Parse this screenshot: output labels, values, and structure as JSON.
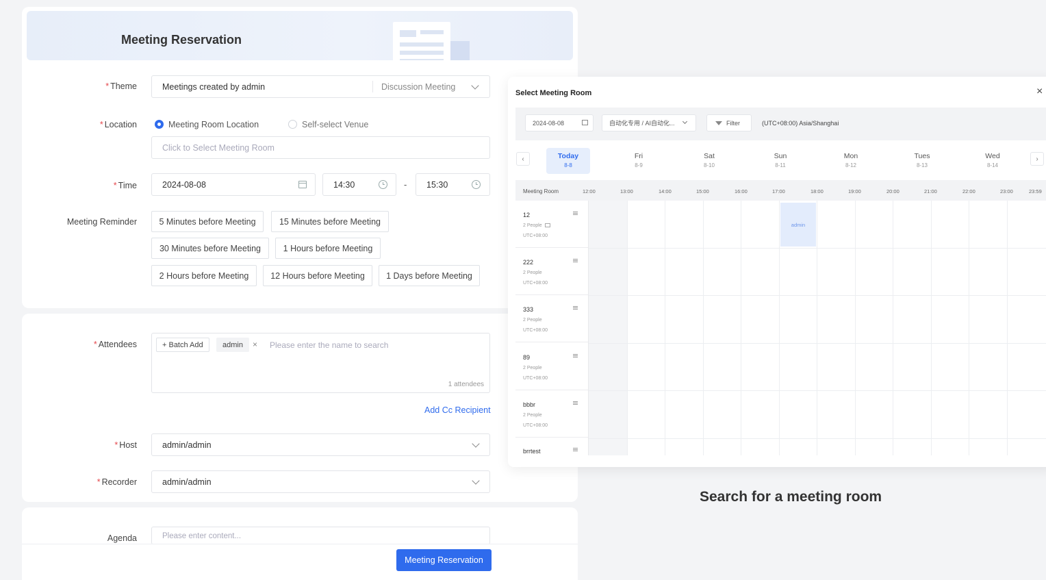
{
  "form": {
    "title": "Meeting Reservation",
    "theme": {
      "label": "Theme",
      "value": "Meetings created by admin",
      "type": "Discussion Meeting"
    },
    "location": {
      "label": "Location",
      "option_room": "Meeting Room Location",
      "option_self": "Self-select Venue",
      "selected": "Meeting Room Location",
      "placeholder": "Click to Select Meeting Room"
    },
    "time": {
      "label": "Time",
      "date": "2024-08-08",
      "start": "14:30",
      "dash": "-",
      "end": "15:30"
    },
    "reminder": {
      "label": "Meeting Reminder",
      "options": [
        "5 Minutes before Meeting",
        "15 Minutes before Meeting",
        "30 Minutes before Meeting",
        "1 Hours before Meeting",
        "2 Hours before Meeting",
        "12 Hours before Meeting",
        "1 Days before Meeting"
      ]
    },
    "attendees": {
      "label": "Attendees",
      "batch_add": "+ Batch Add",
      "tag": "admin",
      "tag_remove": "×",
      "placeholder": "Please enter the name to search",
      "count": "1 attendees",
      "add_cc": "Add Cc Recipient"
    },
    "host": {
      "label": "Host",
      "value": "admin/admin"
    },
    "recorder": {
      "label": "Recorder",
      "value": "admin/admin"
    },
    "agenda": {
      "label": "Agenda",
      "placeholder": "Please enter content..."
    },
    "submit": "Meeting Reservation"
  },
  "room_panel": {
    "title": "Select Meeting Room",
    "close": "×",
    "date": "2024-08-08",
    "org": "自动化专用 / AI自动化...",
    "filter": "Filter",
    "timezone": "(UTC+08:00) Asia/Shanghai",
    "prev": "‹",
    "next": "›",
    "days": [
      {
        "name": "Today",
        "date": "8-8"
      },
      {
        "name": "Fri",
        "date": "8-9"
      },
      {
        "name": "Sat",
        "date": "8-10"
      },
      {
        "name": "Sun",
        "date": "8-11"
      },
      {
        "name": "Mon",
        "date": "8-12"
      },
      {
        "name": "Tues",
        "date": "8-13"
      },
      {
        "name": "Wed",
        "date": "8-14"
      }
    ],
    "grid_label": "Meeting Room",
    "hours": [
      "12:00",
      "13:00",
      "14:00",
      "15:00",
      "16:00",
      "17:00",
      "18:00",
      "19:00",
      "20:00",
      "21:00",
      "22:00",
      "23:00",
      "23:59"
    ],
    "rooms": [
      {
        "name": "12",
        "people": "2 People",
        "tz": "UTC+08:00"
      },
      {
        "name": "222",
        "people": "2 People",
        "tz": "UTC+08:00"
      },
      {
        "name": "333",
        "people": "2 People",
        "tz": "UTC+08:00"
      },
      {
        "name": "89",
        "people": "2 People",
        "tz": "UTC+08:00"
      },
      {
        "name": "bbbr",
        "people": "2 People",
        "tz": "UTC+08:00"
      },
      {
        "name": "brrtest",
        "people": "",
        "tz": ""
      }
    ],
    "booking": "admin"
  },
  "caption": "Search for a meeting room",
  "colors": {
    "primary": "#2f6bed",
    "required": "#e5484d",
    "booking_bg": "#e3ecfc"
  }
}
